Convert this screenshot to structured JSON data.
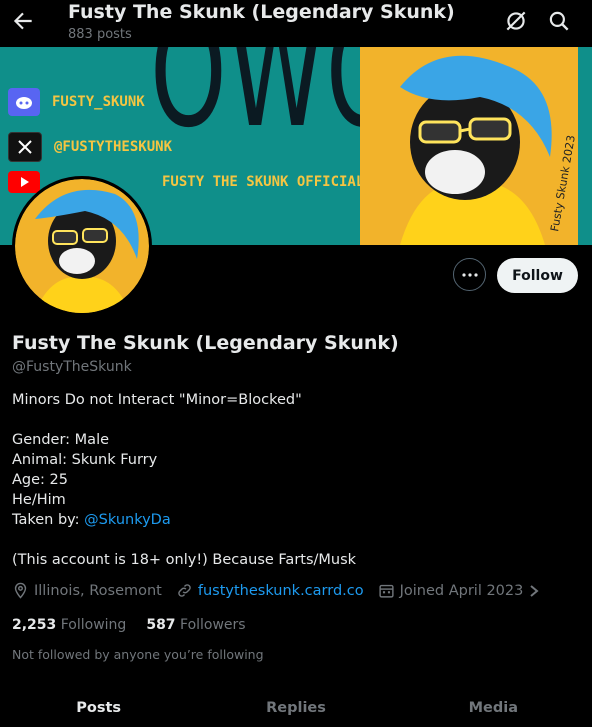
{
  "header": {
    "title": "Fusty The Skunk (Legendary Skunk)",
    "post_count": "883 posts"
  },
  "banner": {
    "big_text": "OWO",
    "socials": [
      {
        "platform": "discord-icon",
        "text": "FUSTY_SKUNK",
        "color": "#5865f2"
      },
      {
        "platform": "x-icon",
        "text": "@FUSTYTHESKUNK",
        "color": "#111111"
      },
      {
        "platform": "youtube-icon",
        "text": "FUSTY THE SKUNK OFFICIAL",
        "color": "#ff0000"
      }
    ],
    "signature": "Fusty Skunk 2023"
  },
  "profile": {
    "name": "Fusty The Skunk (Legendary Skunk)",
    "handle": "@FustyTheSkunk",
    "follow_label": "Follow",
    "bio": {
      "line1": "Minors Do not Interact \"Minor=Blocked\"",
      "gender": "Gender: Male",
      "animal": "Animal: Skunk Furry",
      "age": "Age: 25",
      "pronouns": "He/Him",
      "taken_prefix": "Taken by: ",
      "taken_link": "@SkunkyDa",
      "note": "(This account is 18+ only!) Because Farts/Musk"
    },
    "location": "Illinois, Rosemont",
    "website": "fustytheskunk.carrd.co",
    "joined": "Joined April 2023",
    "following_count": "2,253",
    "following_label": "Following",
    "followers_count": "587",
    "followers_label": "Followers",
    "not_followed": "Not followed by anyone you’re following"
  },
  "tabs": [
    "Posts",
    "Replies",
    "Media"
  ],
  "colors": {
    "accent": "#1d9bf0",
    "banner_teal": "#0f8f8a",
    "banner_yellow": "#f2b32b"
  }
}
